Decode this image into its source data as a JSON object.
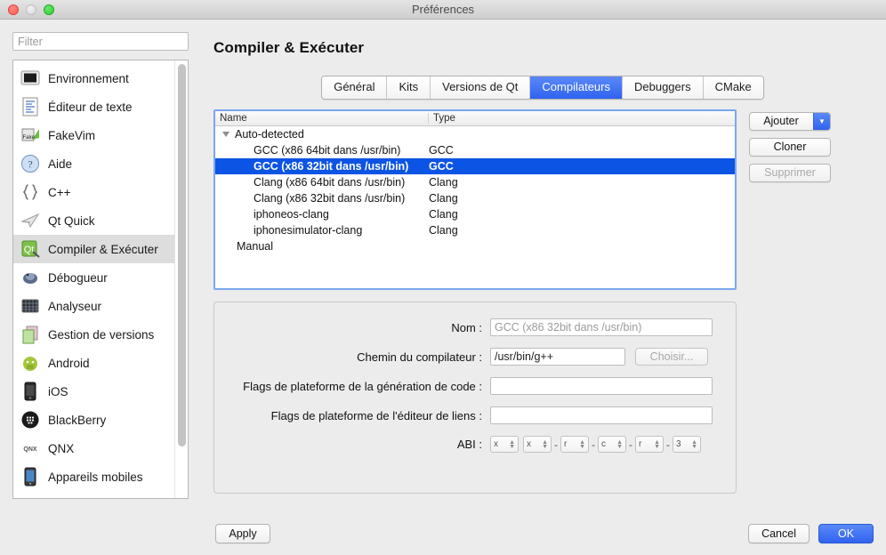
{
  "window": {
    "title": "Préférences",
    "traffic_lights": [
      "close-button",
      "minimize-button",
      "maximize-button"
    ]
  },
  "sidebar": {
    "filter_placeholder": "Filter",
    "items": [
      {
        "label": "Environnement",
        "icon": "monitor-icon",
        "selected": false
      },
      {
        "label": "Éditeur de texte",
        "icon": "text-editor-icon",
        "selected": false
      },
      {
        "label": "FakeVim",
        "icon": "fakevim-icon",
        "selected": false
      },
      {
        "label": "Aide",
        "icon": "help-question-icon",
        "selected": false
      },
      {
        "label": "C++",
        "icon": "braces-icon",
        "selected": false
      },
      {
        "label": "Qt Quick",
        "icon": "paper-plane-icon",
        "selected": false
      },
      {
        "label": "Compiler & Exécuter",
        "icon": "qt-build-icon",
        "selected": true
      },
      {
        "label": "Débogueur",
        "icon": "bug-icon",
        "selected": false
      },
      {
        "label": "Analyseur",
        "icon": "analyzer-grid-icon",
        "selected": false
      },
      {
        "label": "Gestion de versions",
        "icon": "version-control-icon",
        "selected": false
      },
      {
        "label": "Android",
        "icon": "android-icon",
        "selected": false
      },
      {
        "label": "iOS",
        "icon": "iphone-icon",
        "selected": false
      },
      {
        "label": "BlackBerry",
        "icon": "blackberry-icon",
        "selected": false
      },
      {
        "label": "QNX",
        "icon": "qnx-icon",
        "selected": false
      },
      {
        "label": "Appareils mobiles",
        "icon": "mobile-device-icon",
        "selected": false
      }
    ]
  },
  "content": {
    "page_title": "Compiler & Exécuter",
    "tabs": [
      {
        "label": "Général",
        "active": false
      },
      {
        "label": "Kits",
        "active": false
      },
      {
        "label": "Versions de Qt",
        "active": false
      },
      {
        "label": "Compilateurs",
        "active": true
      },
      {
        "label": "Debuggers",
        "active": false
      },
      {
        "label": "CMake",
        "active": false
      }
    ],
    "table": {
      "columns": [
        "Name",
        "Type"
      ],
      "rows": [
        {
          "name": "Auto-detected",
          "type": "",
          "level": 0,
          "expander": "triangle-down-icon",
          "selected": false
        },
        {
          "name": "GCC (x86 64bit dans /usr/bin)",
          "type": "GCC",
          "level": 2,
          "selected": false
        },
        {
          "name": "GCC (x86 32bit dans /usr/bin)",
          "type": "GCC",
          "level": 2,
          "selected": true
        },
        {
          "name": "Clang (x86 64bit dans /usr/bin)",
          "type": "Clang",
          "level": 2,
          "selected": false
        },
        {
          "name": "Clang (x86 32bit dans /usr/bin)",
          "type": "Clang",
          "level": 2,
          "selected": false
        },
        {
          "name": "iphoneos-clang",
          "type": "Clang",
          "level": 2,
          "selected": false
        },
        {
          "name": "iphonesimulator-clang",
          "type": "Clang",
          "level": 2,
          "selected": false
        },
        {
          "name": "Manual",
          "type": "",
          "level": 1,
          "selected": false
        }
      ]
    },
    "side_buttons": {
      "add": "Ajouter",
      "clone": "Cloner",
      "remove": "Supprimer",
      "add_has_dropdown": true,
      "remove_disabled": true
    },
    "form": {
      "name_label": "Nom :",
      "name_value": "GCC (x86 32bit dans /usr/bin)",
      "path_label": "Chemin du compilateur :",
      "path_value": "/usr/bin/g++",
      "choose_button": "Choisir...",
      "codegen_flags_label": "Flags de plateforme de la génération de code :",
      "codegen_flags_value": "",
      "linker_flags_label": "Flags de plateforme de l'éditeur de liens :",
      "linker_flags_value": "",
      "abi_label": "ABI :",
      "abi_parts": [
        "x",
        "x",
        "r",
        "c",
        "r",
        "3"
      ],
      "abi_separator": "-"
    }
  },
  "footer": {
    "apply": "Apply",
    "cancel": "Cancel",
    "ok": "OK"
  },
  "colors": {
    "accent_blue": "#2f63ef",
    "selection_blue": "#0c54e4",
    "window_bg": "#ececec",
    "focus_ring": "#7aa7f0"
  }
}
